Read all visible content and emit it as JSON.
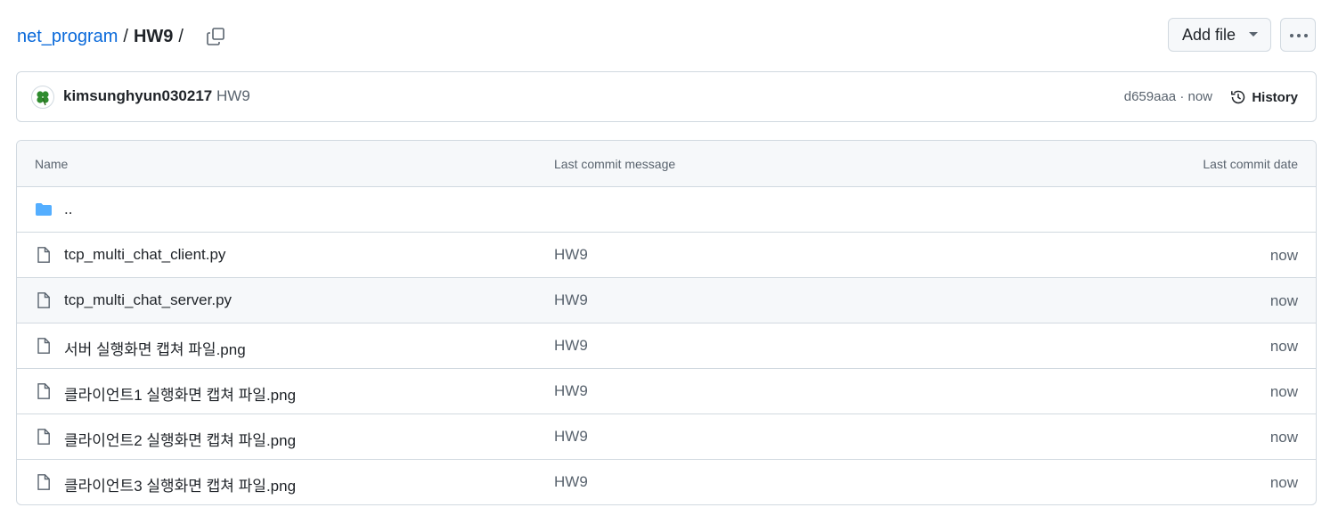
{
  "breadcrumb": {
    "repo": "net_program",
    "sep": "/",
    "folder": "HW9",
    "trail": "/"
  },
  "actions": {
    "add_file": "Add file"
  },
  "commit": {
    "author": "kimsunghyun030217",
    "message": "HW9",
    "sha_time": "d659aaa · now",
    "history": "History"
  },
  "table": {
    "headers": {
      "name": "Name",
      "message": "Last commit message",
      "date": "Last commit date"
    },
    "parent": "..",
    "rows": [
      {
        "name": "tcp_multi_chat_client.py",
        "message": "HW9",
        "date": "now"
      },
      {
        "name": "tcp_multi_chat_server.py",
        "message": "HW9",
        "date": "now"
      },
      {
        "name": "서버 실행화면 캡쳐 파일.png",
        "message": "HW9",
        "date": "now"
      },
      {
        "name": "클라이언트1 실행화면 캡쳐 파일.png",
        "message": "HW9",
        "date": "now"
      },
      {
        "name": "클라이언트2 실행화면 캡쳐 파일.png",
        "message": "HW9",
        "date": "now"
      },
      {
        "name": "클라이언트3 실행화면 캡쳐 파일.png",
        "message": "HW9",
        "date": "now"
      }
    ]
  },
  "colors": {
    "link": "#0969da",
    "folder": "#54aeff",
    "muted": "#59636e",
    "border": "#d1d9e0",
    "header_bg": "#f6f8fa"
  },
  "icons": [
    "copy-icon",
    "caret-down-icon",
    "kebab-icon",
    "clover-avatar",
    "history-icon",
    "folder-icon",
    "file-icon"
  ]
}
